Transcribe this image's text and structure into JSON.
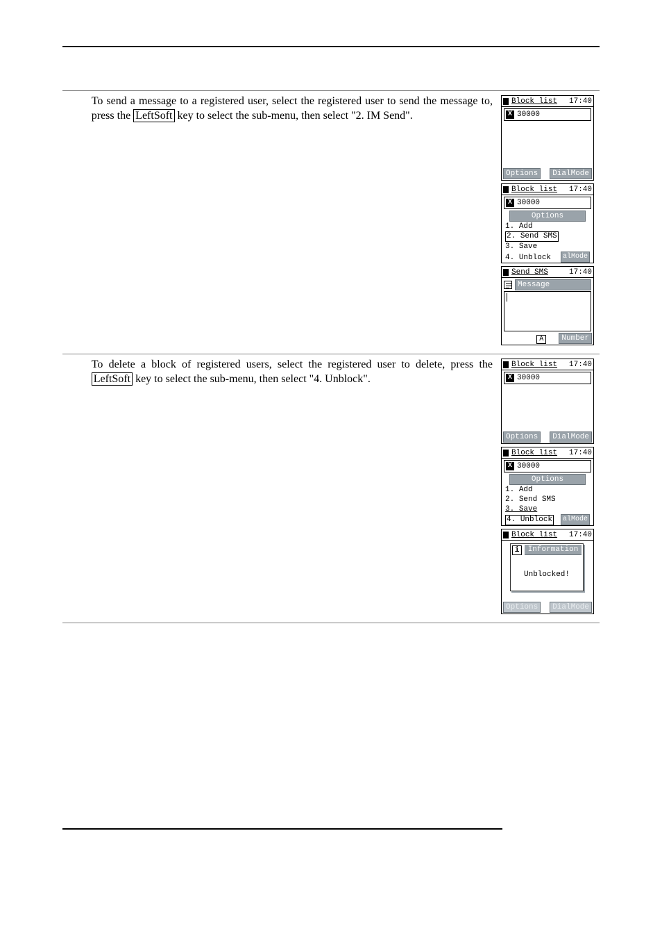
{
  "rows": [
    {
      "desc_pre": "To send a message to a registered user, select the registered user to send the message to, press the ",
      "key": "LeftSoft",
      "desc_post": " key to select the sub-menu, then select \"2. IM Send\"."
    },
    {
      "desc_pre": "To delete a block of registered users, select the registered user to delete, press the ",
      "key": "LeftSoft",
      "desc_post": " key to select the sub-menu, then select \"4. Unblock\"."
    }
  ],
  "common": {
    "time": "17:40",
    "options": "Options",
    "dialmode": "DialMode",
    "almode": "alMode",
    "number_entry": "30000",
    "block_title": "Block list"
  },
  "menu": {
    "hdr": "Options",
    "i1": "1. Add",
    "i2": "2. Send SMS",
    "i3": "3. Save",
    "i4": "4. Unblock"
  },
  "sendsms": {
    "title": "Send SMS",
    "label": "Message",
    "mid": "A",
    "right": "Number"
  },
  "popup": {
    "hdr": "Information",
    "msg": "Unblocked!"
  }
}
